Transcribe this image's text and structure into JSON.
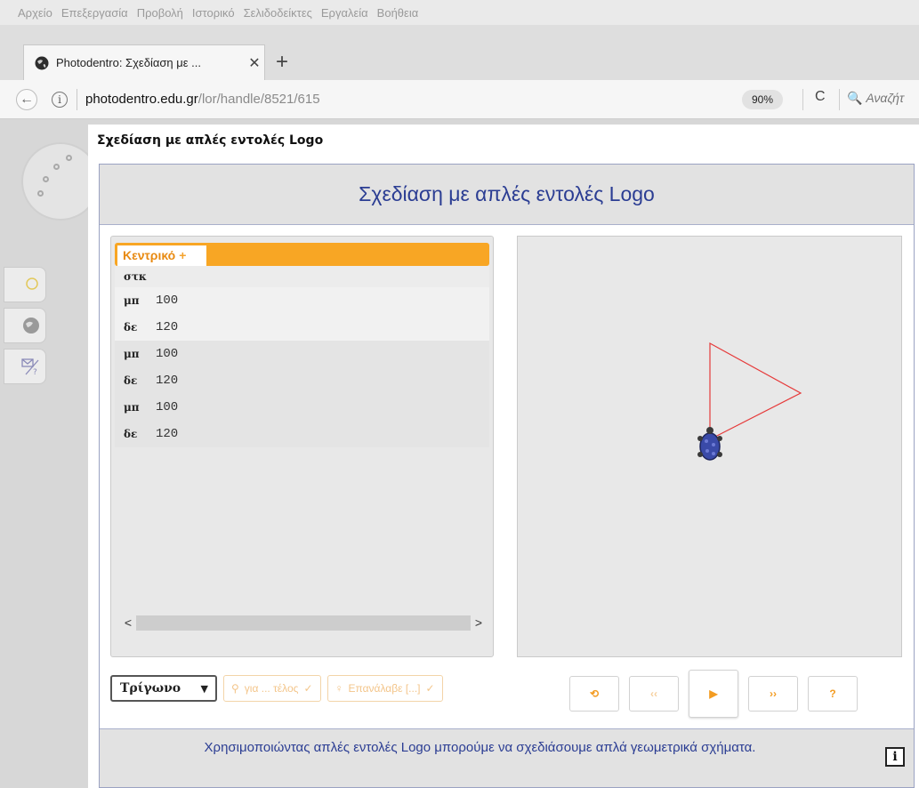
{
  "menubar": {
    "items": [
      "Αρχείο",
      "Επεξεργασία",
      "Προβολή",
      "Ιστορικό",
      "Σελιδοδείκτες",
      "Εργαλεία",
      "Βοήθεια"
    ]
  },
  "browser": {
    "tab_title": "Photodentro: Σχεδίαση με ...",
    "close_glyph": "✕",
    "new_tab_glyph": "+",
    "url_domain": "photodentro.edu.gr",
    "url_path": "/lor/handle/8521/615",
    "zoom": "90%",
    "search_placeholder": "Αναζήτ",
    "back_glyph": "←",
    "info_glyph": "i",
    "reload_glyph": "C",
    "search_glyph": "🔍"
  },
  "modal": {
    "title": "Σχεδίαση με απλές εντολές Logo"
  },
  "app": {
    "header_title": "Σχεδίαση με απλές εντολές Logo",
    "code_tab_label": "Κεντρικό",
    "code_tab_plus": "+",
    "code_lines": [
      {
        "cmd": "στκ",
        "arg": ""
      },
      {
        "cmd": "μπ",
        "arg": "100"
      },
      {
        "cmd": "δε",
        "arg": "120"
      },
      {
        "cmd": "μπ",
        "arg": "100"
      },
      {
        "cmd": "δε",
        "arg": "120"
      },
      {
        "cmd": "μπ",
        "arg": "100"
      },
      {
        "cmd": "δε",
        "arg": "120"
      }
    ],
    "scroll_left": "<",
    "scroll_right": ">",
    "shape_select": "Τρίγωνο",
    "procedure_button": "για ... τέλος",
    "repeat_button": "Επανάλαβε [...]",
    "footer_text": "Χρησιμοποιώντας απλές εντολές Logo μπορούμε να σχεδιάσουμε απλά γεωμετρικά σχήματα.",
    "footer_info": "i",
    "player": {
      "reset": "⟲",
      "prev": "‹‹",
      "play": "▶",
      "next": "››",
      "help": "?"
    }
  },
  "colors": {
    "accent_orange": "#f8a624",
    "title_blue": "#2b3d93",
    "line_red": "#e63a3a",
    "turtle_blue": "#3a4aa8"
  }
}
